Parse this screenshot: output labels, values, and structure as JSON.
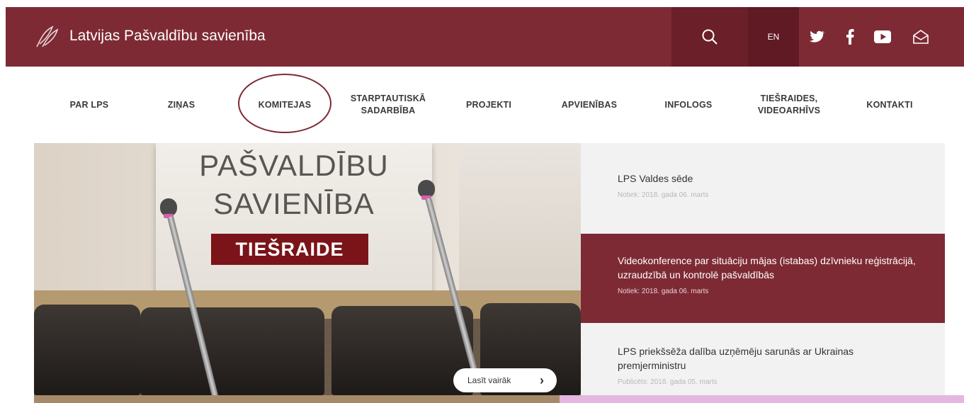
{
  "header": {
    "site_title": "Latvijas Pašvaldību savienība",
    "lang_label": "EN",
    "icons": [
      "logo-icon",
      "search-icon",
      "twitter-icon",
      "facebook-icon",
      "youtube-icon",
      "mail-icon"
    ],
    "brand_color": "#7e2a34"
  },
  "nav": {
    "items": [
      {
        "label": "PAR LPS"
      },
      {
        "label": "ZIŅAS"
      },
      {
        "label": "KOMITEJAS",
        "highlighted": true
      },
      {
        "label_1": "STARPTAUTISKĀ",
        "label_2": "SADARBĪBA"
      },
      {
        "label": "PROJEKTI"
      },
      {
        "label": "APVIENĪBAS"
      },
      {
        "label": "INFOLOGS"
      },
      {
        "label_1": "TIEŠRAIDES,",
        "label_2": "VIDEOARHĪVS"
      },
      {
        "label": "KONTAKTI"
      }
    ]
  },
  "hero": {
    "sign_line_1": "PAŠVALDĪBU",
    "sign_line_2": "SAVIENĪBA",
    "live_label": "TIEŠRAIDE",
    "read_more": "Lasīt vairāk"
  },
  "news": [
    {
      "title": "LPS Valdes sēde",
      "date": "Notiek: 2018. gada 06. marts",
      "active": false
    },
    {
      "title": "Videokonference par situāciju mājas (istabas) dzīvnieku reģistrācijā, uzraudzībā un kontrolē pašvaldībās",
      "date": "Notiek: 2018. gada 06. marts",
      "active": true
    },
    {
      "title": "LPS priekšsēža dalība uzņēmēju sarunās ar Ukrainas premjerministru",
      "date": "Publicēts: 2018. gada 05. marts",
      "active": false
    }
  ]
}
